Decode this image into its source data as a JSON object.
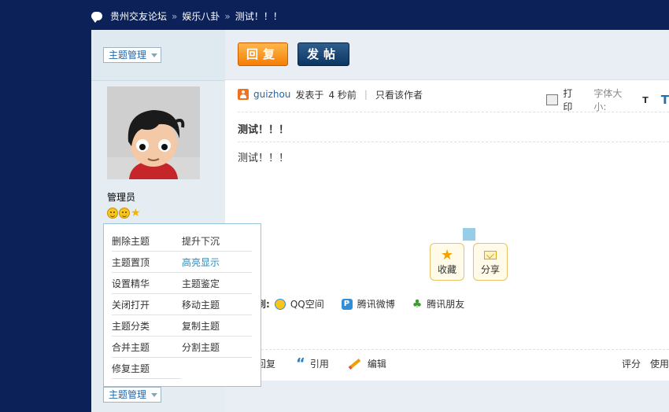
{
  "breadcrumb": {
    "forum": "贵州交友论坛",
    "sep1": "»",
    "board": "娱乐八卦",
    "sep2": "»",
    "thread": "测试！！！"
  },
  "sidebar": {
    "top_dropdown": "主题管理",
    "bottom_dropdown": "主题管理",
    "user_role": "管理员"
  },
  "buttons": {
    "reply": "回复",
    "post": "发帖"
  },
  "post": {
    "author": "guizhou",
    "posted_prefix": "发表于",
    "posted_time": "4 秒前",
    "only_author": "只看该作者",
    "print": "打印",
    "font_size_label": "字体大小:",
    "font_small": "T",
    "font_large": "T",
    "title": "测试！！！",
    "body": "测试！！！"
  },
  "actions": {
    "favorite": "收藏",
    "share": "分享"
  },
  "share": {
    "label": "到:",
    "qzone": "QQ空间",
    "weibo": "腾讯微博",
    "pengyou": "腾讯朋友"
  },
  "bottom": {
    "reply": "回复",
    "quote": "引用",
    "edit": "编辑",
    "rate": "评分",
    "use": "使用"
  },
  "menu": {
    "items": [
      [
        "删除主题",
        "提升下沉"
      ],
      [
        "主题置顶",
        "高亮显示"
      ],
      [
        "设置精华",
        "主题鉴定"
      ],
      [
        "关闭打开",
        "移动主题"
      ],
      [
        "主题分类",
        "复制主题"
      ],
      [
        "合并主题",
        "分割主题"
      ],
      [
        "修复主题",
        ""
      ]
    ]
  },
  "colors": {
    "nav_bg": "#0b2157",
    "link": "#2366a8",
    "reply_btn": "#f57e07",
    "post_btn": "#0d3561",
    "highlight": "#2c8ab8"
  }
}
